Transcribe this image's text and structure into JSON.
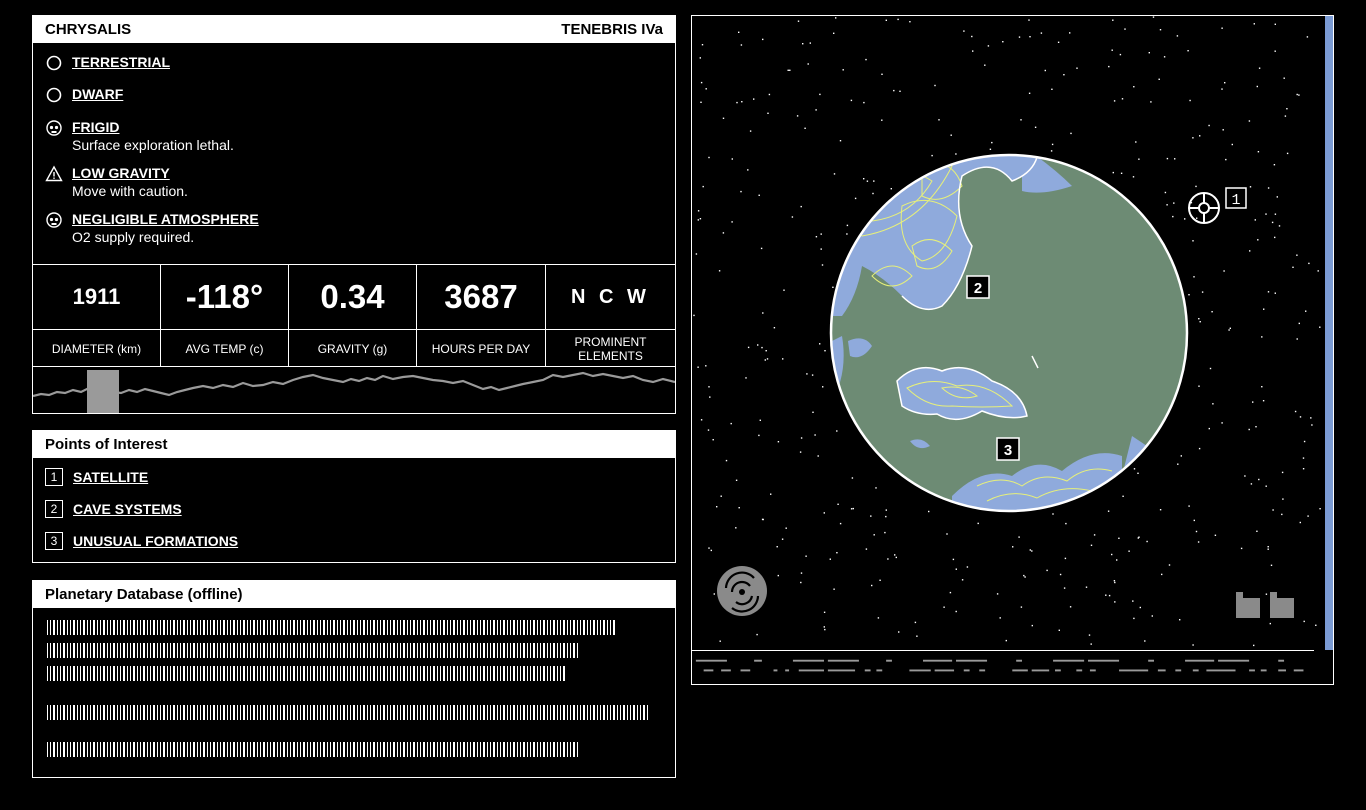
{
  "planet": {
    "name": "CHRYSALIS",
    "system": "TENEBRIS IVa",
    "traits": [
      {
        "icon": "circle-icon",
        "title": "TERRESTRIAL",
        "note": ""
      },
      {
        "icon": "circle-icon",
        "title": "DWARF",
        "note": ""
      },
      {
        "icon": "skull-icon",
        "title": "FRIGID",
        "note": "Surface exploration lethal."
      },
      {
        "icon": "warning-icon",
        "title": "LOW GRAVITY",
        "note": "Move with caution."
      },
      {
        "icon": "skull-icon",
        "title": "NEGLIGIBLE ATMOSPHERE",
        "note": "O2 supply required."
      }
    ],
    "stats": [
      {
        "value": "1911",
        "label": "DIAMETER (km)"
      },
      {
        "value": "-118°",
        "label": "AVG TEMP (c)"
      },
      {
        "value": "0.34",
        "label": "GRAVITY (g)"
      },
      {
        "value": "3687",
        "label": "HOURS PER DAY"
      },
      {
        "value": "N C W",
        "label": "PROMINENT ELEMENTS"
      }
    ]
  },
  "poi": {
    "title": "Points of Interest",
    "items": [
      {
        "num": "1",
        "label": "SATELLITE"
      },
      {
        "num": "2",
        "label": "CAVE SYSTEMS"
      },
      {
        "num": "3",
        "label": "UNUSUAL FORMATIONS"
      }
    ]
  },
  "database": {
    "title": "Planetary Database (offline)"
  },
  "viewer": {
    "markers": [
      "1",
      "2",
      "3"
    ]
  },
  "colors": {
    "ocean": "#8faadc",
    "land": "#6d8b74",
    "contour": "#e7f07a",
    "scroll": "#7b9bd4"
  }
}
